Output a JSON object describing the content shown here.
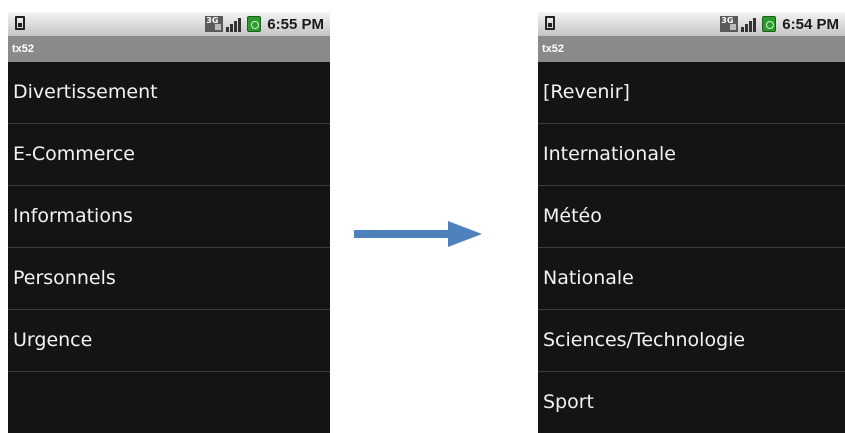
{
  "left_screen": {
    "status_bar": {
      "time": "6:55 PM",
      "network_badge": "3G",
      "icons": [
        "sim-icon",
        "3g-icon",
        "signal-icon",
        "battery-icon"
      ]
    },
    "app_title": "tx52",
    "items": [
      "Divertissement",
      "E-Commerce",
      "Informations",
      "Personnels",
      "Urgence"
    ]
  },
  "right_screen": {
    "status_bar": {
      "time": "6:54 PM",
      "network_badge": "3G",
      "icons": [
        "sim-icon",
        "3g-icon",
        "signal-icon",
        "battery-icon"
      ]
    },
    "app_title": "tx52",
    "items": [
      "[Revenir]",
      "Internationale",
      "Météo",
      "Nationale",
      "Sciences/Technologie",
      "Sport"
    ]
  },
  "arrow": {
    "icon": "arrow-right-icon",
    "color": "#4f81bd"
  },
  "colors": {
    "list_background": "#141414",
    "title_bar": "#8a8a8a",
    "item_text": "#f2f2f2",
    "divider": "#3b3b3b"
  }
}
